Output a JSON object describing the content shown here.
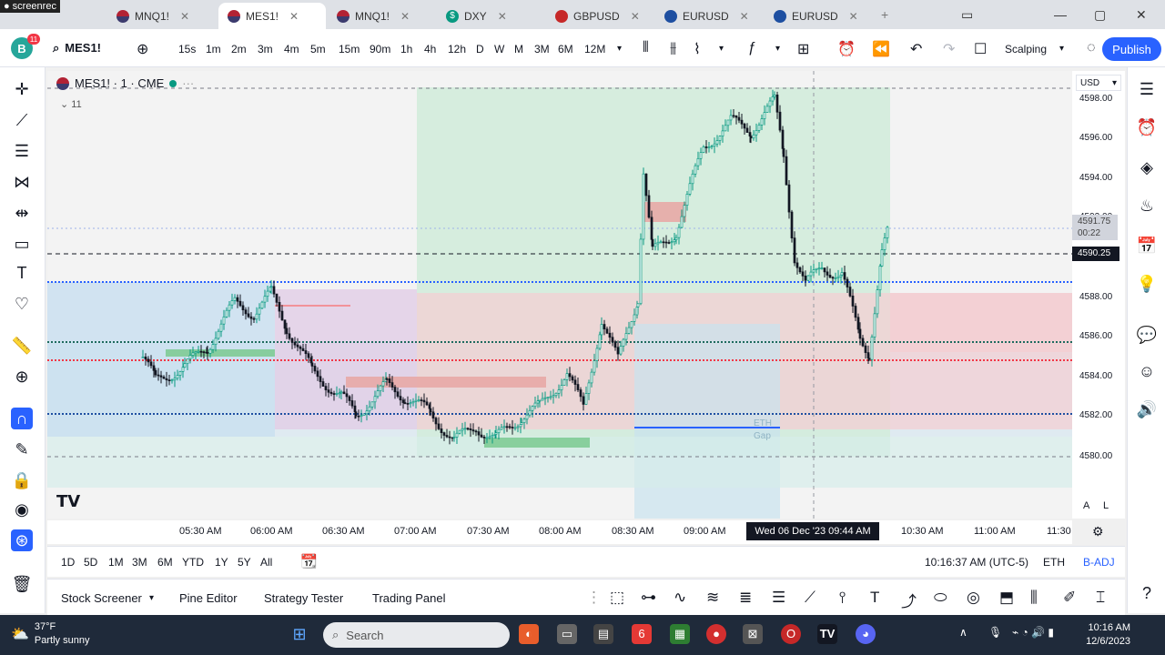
{
  "browser": {
    "recorder": "screenrec",
    "tabs": [
      {
        "label": "MNQ1!",
        "active": false
      },
      {
        "label": "MES1!",
        "active": true
      },
      {
        "label": "MNQ1!",
        "active": false
      },
      {
        "label": "DXY",
        "active": false
      },
      {
        "label": "GBPUSD",
        "active": false
      },
      {
        "label": "EURUSD",
        "active": false
      },
      {
        "label": "EURUSD",
        "active": false
      }
    ]
  },
  "toolbar": {
    "avatar_letter": "B",
    "avatar_badge": "11",
    "symbol": "MES1!",
    "intervals": [
      "15s",
      "1m",
      "2m",
      "3m",
      "4m",
      "5m",
      "15m",
      "90m",
      "1h",
      "4h",
      "12h",
      "D",
      "W",
      "M",
      "3M",
      "6M",
      "12M"
    ],
    "layout_name": "Scalping",
    "publish_label": "Publish"
  },
  "chart": {
    "title": "MES1! · 1 · CME",
    "collapse_count": "11",
    "currency": "USD",
    "last_price": "4591.75",
    "countdown": "00:22",
    "cursor_price": "4590.25",
    "cursor_time": "Wed 06 Dec '23  09:44 AM",
    "box_label_1": "ETH",
    "box_label_2": "Gap",
    "price_ticks": [
      "4598.00",
      "4596.00",
      "4594.00",
      "4592.00",
      "4590.00",
      "4588.00",
      "4586.00",
      "4584.00",
      "4582.00",
      "4580.00"
    ],
    "time_ticks": [
      "05:30 AM",
      "06:00 AM",
      "06:30 AM",
      "07:00 AM",
      "07:30 AM",
      "08:00 AM",
      "08:30 AM",
      "09:00 AM",
      "10:30 AM",
      "11:00 AM",
      "11:30"
    ],
    "scale_auto": "A",
    "scale_log": "L"
  },
  "rangebar": {
    "ranges": [
      "1D",
      "5D",
      "1M",
      "3M",
      "6M",
      "YTD",
      "1Y",
      "5Y",
      "All"
    ],
    "clock": "10:16:37 AM (UTC-5)",
    "session": "ETH",
    "adjust": "B-ADJ"
  },
  "bottom_tabs": [
    "Stock Screener",
    "Pine Editor",
    "Strategy Tester",
    "Trading Panel"
  ],
  "taskbar": {
    "weather_temp": "37°F",
    "weather_desc": "Partly sunny",
    "search_placeholder": "Search",
    "time": "10:16 AM",
    "date": "12/6/2023"
  },
  "colors": {
    "accent": "#2962ff",
    "candle_up": "#089981",
    "candle_down": "#131722",
    "green_zone": "#d3ecdc",
    "red_zone": "#f3cfd3",
    "blue_zone": "#c8dff0",
    "purple_zone": "#e2cfe6"
  }
}
